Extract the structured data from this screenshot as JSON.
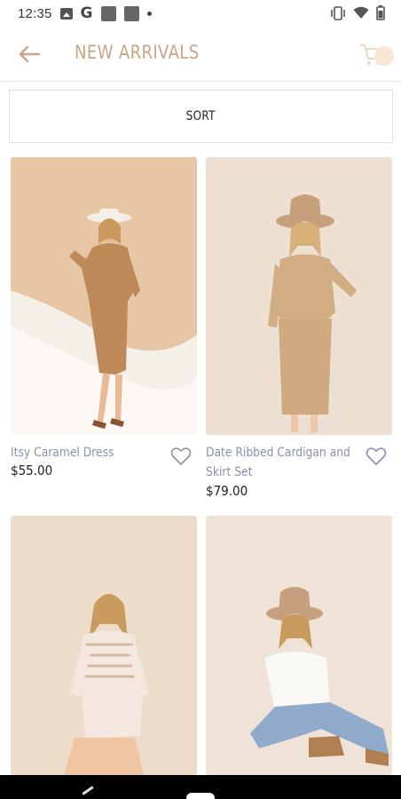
{
  "status_bar": {
    "time": "12:35",
    "icons": [
      "image-icon",
      "google-icon",
      "notification-square-icon",
      "notification-square-icon",
      "dot-icon",
      "vibrate-icon",
      "wifi-icon",
      "battery-icon"
    ],
    "google_glyph": "G"
  },
  "header": {
    "title": "NEW ARRIVALS",
    "back_icon": "arrow-left-icon",
    "cart_icon": "cart-icon",
    "accent_color": "#c9a586"
  },
  "sort": {
    "label": "SORT"
  },
  "products": [
    {
      "name": "Itsy Caramel Dress",
      "price": "$55.00"
    },
    {
      "name": "Date Ribbed Cardigan and Skirt Set",
      "price": "$79.00"
    },
    {
      "name": "",
      "price": ""
    },
    {
      "name": "",
      "price": ""
    }
  ],
  "colors": {
    "product_name": "#8c8fae",
    "price": "#222222",
    "title": "#c9a586"
  }
}
